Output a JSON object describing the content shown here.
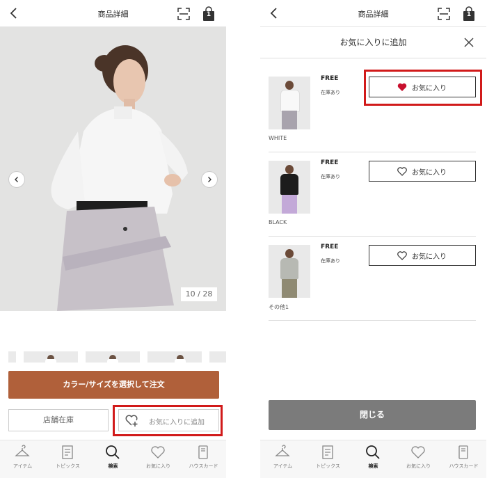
{
  "screen1": {
    "header": {
      "title": "商品詳細",
      "cart_count": "1"
    },
    "gallery": {
      "counter": "10 / 28"
    },
    "order_button": "カラー/サイズを選択して注文",
    "store_stock_button": "店舗在庫",
    "add_favorite_button": "お気に入りに追加"
  },
  "screen2": {
    "header": {
      "title": "商品詳細",
      "cart_count": "1"
    },
    "sheet": {
      "title": "お気に入りに追加",
      "items": [
        {
          "size": "FREE",
          "stock": "在庫あり",
          "color": "WHITE",
          "button": "お気に入り",
          "favorited": true
        },
        {
          "size": "FREE",
          "stock": "在庫あり",
          "color": "BLACK",
          "button": "お気に入り",
          "favorited": false
        },
        {
          "size": "FREE",
          "stock": "在庫あり",
          "color": "その他1",
          "button": "お気に入り",
          "favorited": false
        }
      ],
      "close_button": "閉じる"
    }
  },
  "tabbar": [
    {
      "label": "アイテム",
      "icon": "hanger-icon",
      "active": false
    },
    {
      "label": "トピックス",
      "icon": "document-icon",
      "active": false
    },
    {
      "label": "検索",
      "icon": "search-icon",
      "active": true
    },
    {
      "label": "お気に入り",
      "icon": "heart-icon",
      "active": false
    },
    {
      "label": "ハウスカード",
      "icon": "card-icon",
      "active": false
    }
  ],
  "colors": {
    "accent": "#b0603a",
    "highlight": "#d11a1a",
    "heart": "#c8102e",
    "close_button": "#7b7b7b"
  }
}
